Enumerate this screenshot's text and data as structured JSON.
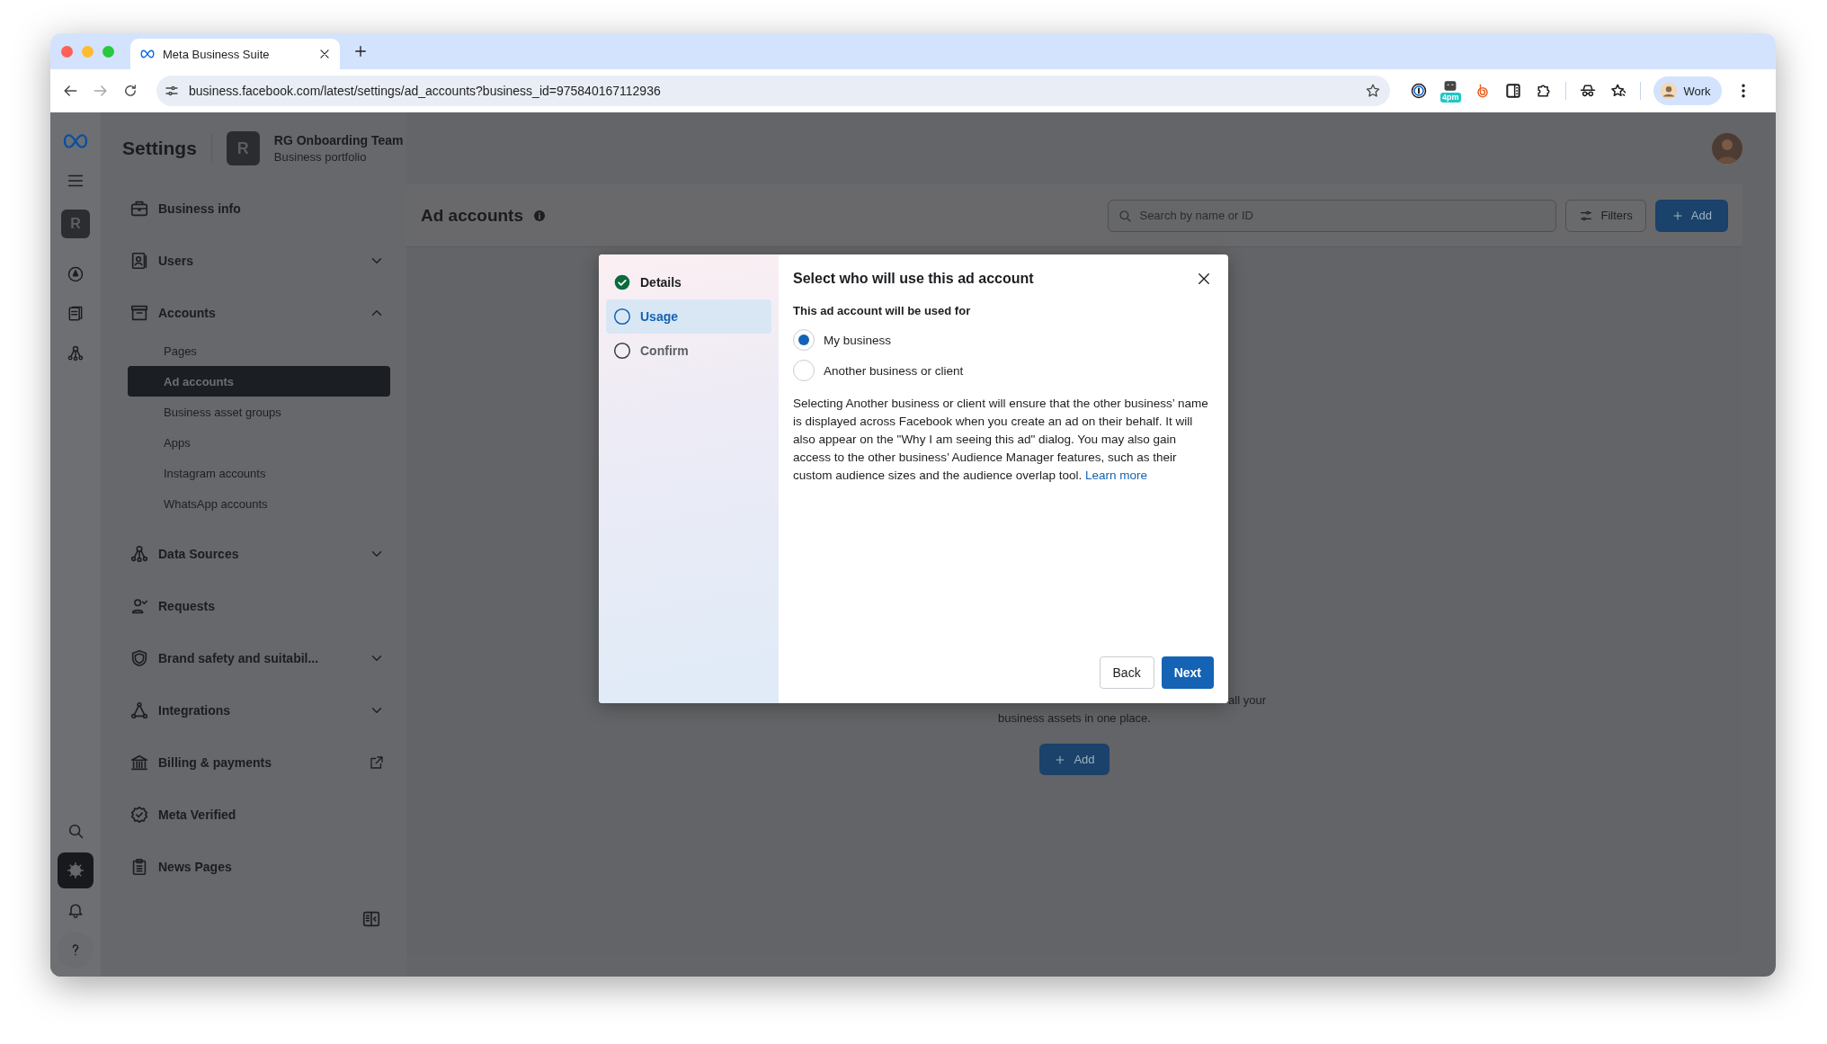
{
  "browser": {
    "tab": {
      "title": "Meta Business Suite"
    },
    "url": "business.facebook.com/latest/settings/ad_accounts?business_id=975840167112936",
    "extensions": [
      {
        "kind": "password"
      },
      {
        "kind": "calendar",
        "badge": "4pm"
      },
      {
        "kind": "bitly"
      },
      {
        "kind": "reader"
      },
      {
        "kind": "puzzle"
      },
      {
        "kind": "spy"
      },
      {
        "kind": "bookmarks"
      }
    ],
    "profile": "Work"
  },
  "rail": {
    "avatar": "R",
    "items": [
      {
        "kind": "compass",
        "selected": false
      },
      {
        "kind": "pages",
        "selected": false
      },
      {
        "kind": "network",
        "selected": false
      }
    ],
    "bottom_items": [
      {
        "kind": "search",
        "selected": false
      },
      {
        "kind": "settings",
        "selected": true
      },
      {
        "kind": "bell",
        "selected": false
      },
      {
        "kind": "help",
        "selected": false
      }
    ]
  },
  "header": {
    "title": "Settings",
    "business": {
      "avatar": "R",
      "name": "RG Onboarding Team",
      "subtitle": "Business portfolio"
    }
  },
  "sidebar": {
    "items": [
      {
        "kind": "briefcase",
        "label": "Business info"
      },
      {
        "kind": "badge",
        "label": "Users",
        "expanded": false
      },
      {
        "kind": "archive",
        "label": "Accounts",
        "expanded": true,
        "children": [
          {
            "label": "Pages",
            "selected": false
          },
          {
            "label": "Ad accounts",
            "selected": true
          },
          {
            "label": "Business asset groups",
            "selected": false
          },
          {
            "label": "Apps",
            "selected": false
          },
          {
            "label": "Instagram accounts",
            "selected": false
          },
          {
            "label": "WhatsApp accounts",
            "selected": false
          }
        ]
      },
      {
        "kind": "network",
        "label": "Data Sources",
        "expanded": false
      },
      {
        "kind": "person",
        "label": "Requests"
      },
      {
        "kind": "shield",
        "label": "Brand safety and suitabil...",
        "expanded": false
      },
      {
        "kind": "triangle",
        "label": "Integrations",
        "expanded": false
      },
      {
        "kind": "bank",
        "label": "Billing & payments",
        "external": true
      },
      {
        "kind": "verified",
        "label": "Meta Verified"
      },
      {
        "kind": "clipboard",
        "label": "News Pages"
      }
    ]
  },
  "main": {
    "title": "Ad accounts",
    "search": {
      "placeholder": "Search by name or ID"
    },
    "filters_button": "Filters",
    "add_button": "Add"
  },
  "empty_state": {
    "text_end": "all your",
    "text_line": "business assets in one place.",
    "add_button": "Add"
  },
  "dialog": {
    "steps": [
      {
        "label": "Details",
        "done": true,
        "selected": false
      },
      {
        "label": "Usage",
        "done": false,
        "selected": true
      },
      {
        "label": "Confirm",
        "done": false,
        "selected": false
      }
    ],
    "title": "Select who will use this ad account",
    "question": "This ad account will be used for",
    "options": [
      {
        "label": "My business",
        "selected": true
      },
      {
        "label": "Another business or client",
        "selected": false
      }
    ],
    "description": "Selecting Another business or client will ensure that the other business’ name is displayed across Facebook when you create an ad on their behalf. It will also appear on the \"Why I am seeing this ad\" dialog. You may also gain access to the other business’ Audience Manager features, such as their custom audience sizes and the audience overlap tool.",
    "link": "Learn more",
    "back_button": "Back",
    "next_button": "Next"
  }
}
